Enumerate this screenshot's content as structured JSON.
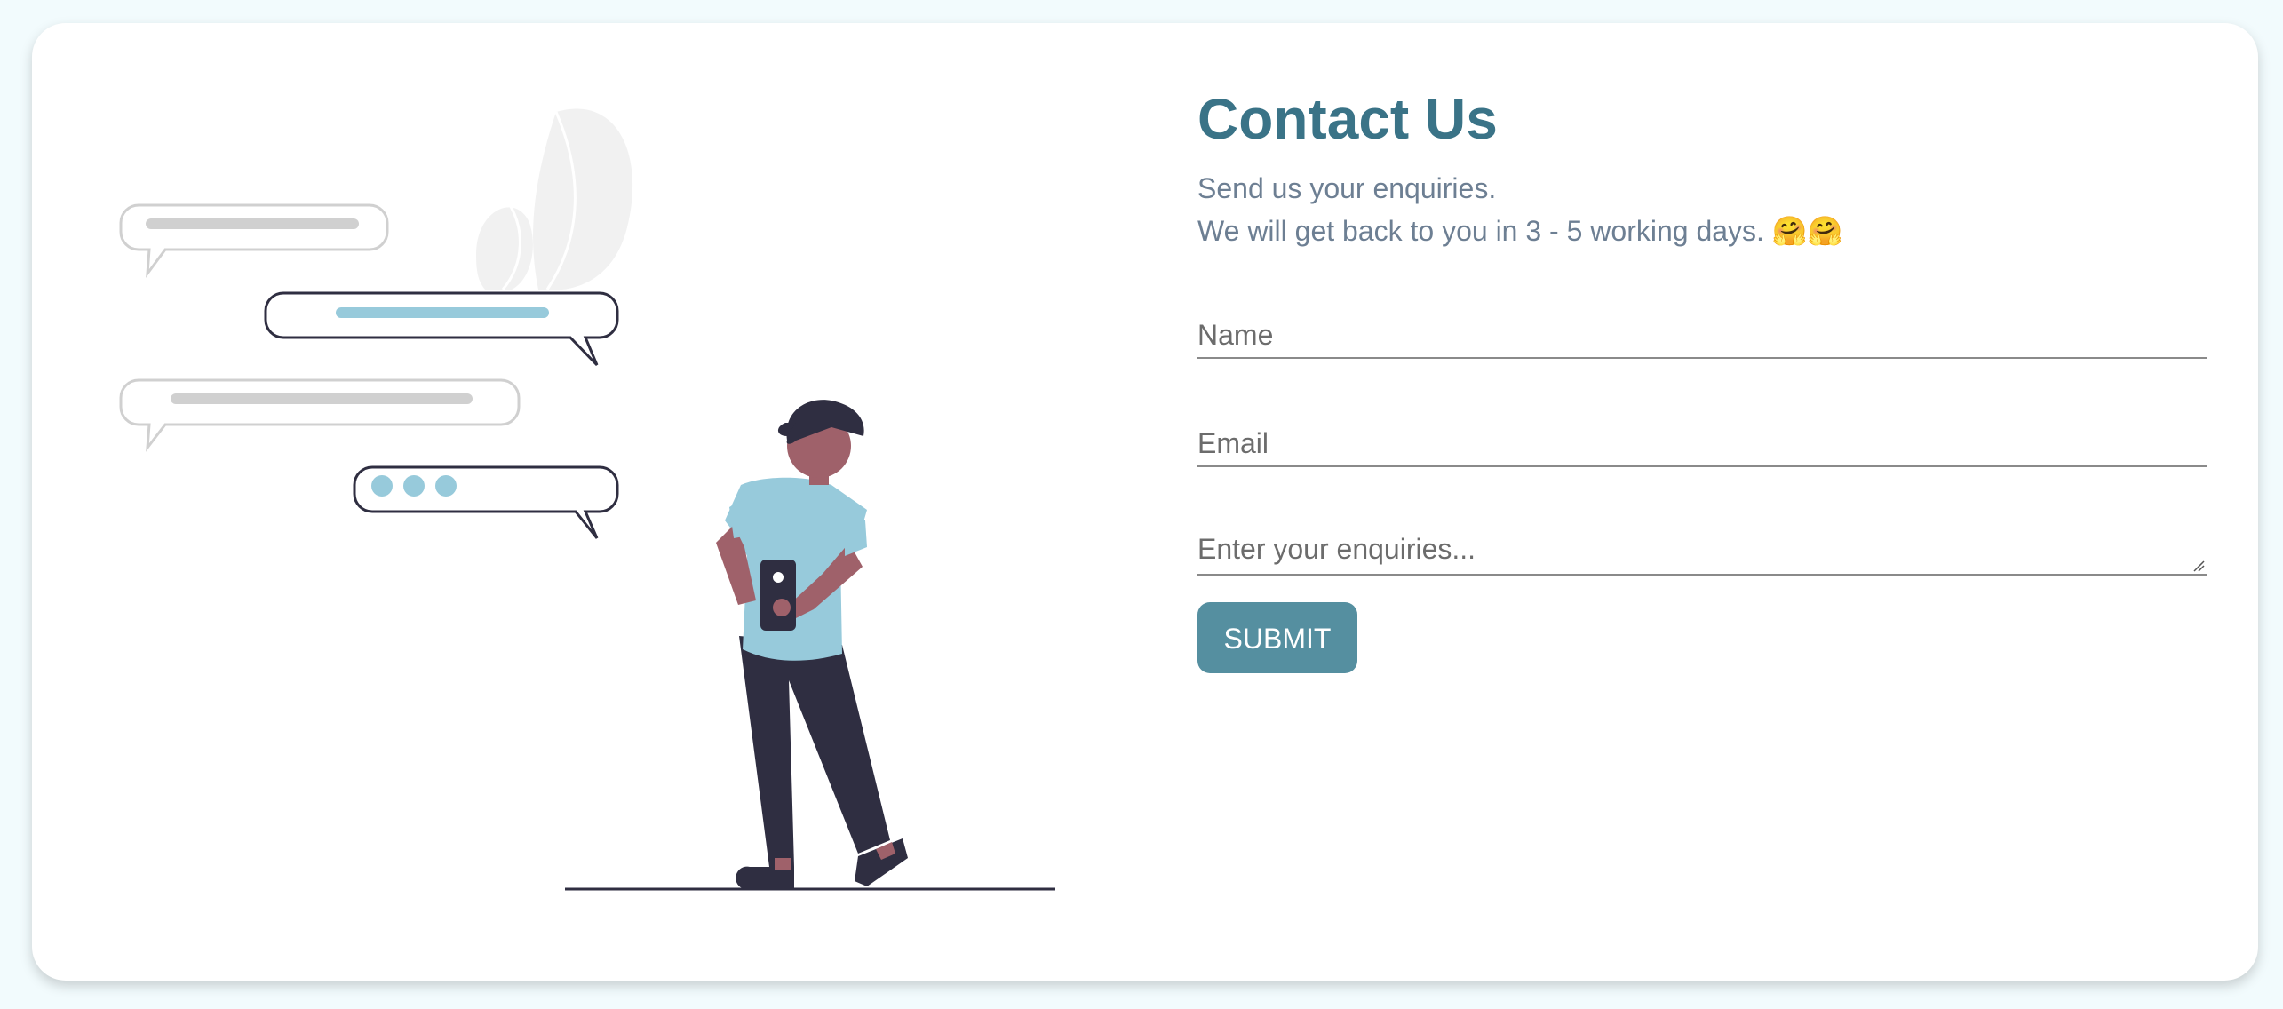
{
  "contact": {
    "title": "Contact Us",
    "subtitle_line1": "Send us your enquiries.",
    "subtitle_line2": "We will get back to you in 3 - 5 working days.",
    "emoji": "🤗🤗"
  },
  "form": {
    "name_placeholder": "Name",
    "email_placeholder": "Email",
    "enquiry_placeholder": "Enter your enquiries...",
    "submit_label": "SUBMIT"
  },
  "colors": {
    "background": "#f2fbfd",
    "title": "#3a7387",
    "subtitle": "#6d7f93",
    "button": "#558fa0",
    "accent_light_blue": "#97cadb",
    "dark": "#2f2e41",
    "skin": "#9f616a",
    "gray_bubble": "#d0d0d0"
  },
  "illustration": {
    "name": "person-with-phone-chat-illustration"
  }
}
